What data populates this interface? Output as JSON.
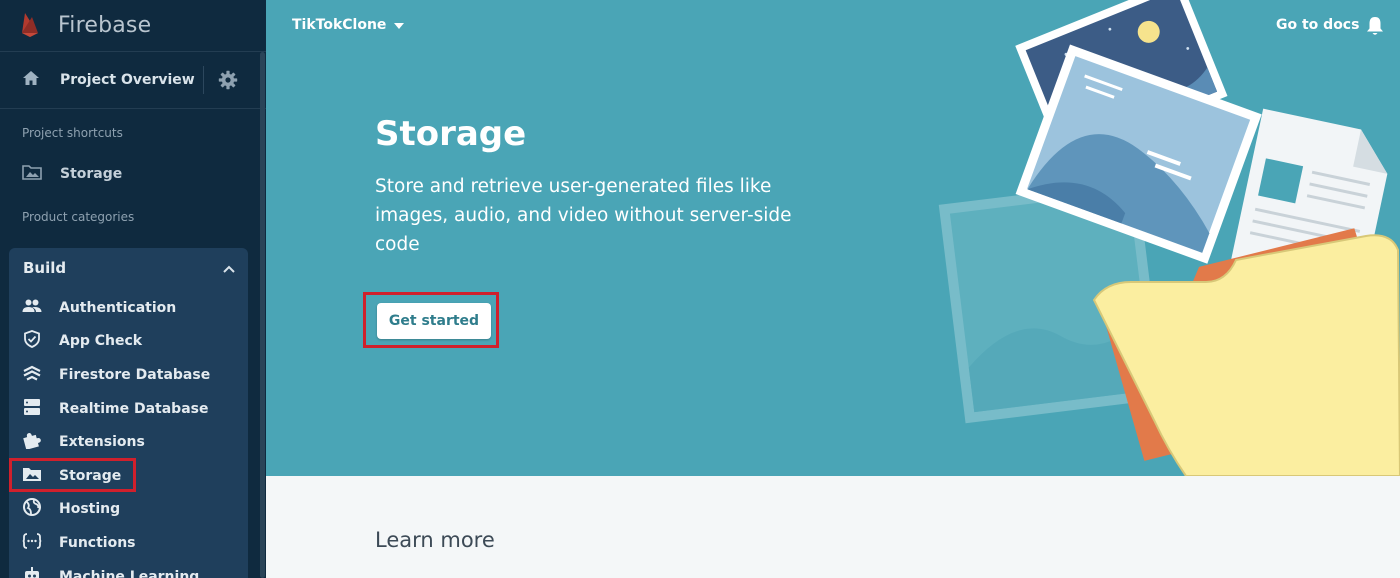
{
  "sidebar": {
    "brand": "Firebase",
    "overview_label": "Project Overview",
    "shortcuts_heading": "Project shortcuts",
    "shortcut_storage": "Storage",
    "categories_heading": "Product categories",
    "build_label": "Build",
    "build_items": [
      {
        "label": "Authentication",
        "icon": "people-icon"
      },
      {
        "label": "App Check",
        "icon": "shield-icon"
      },
      {
        "label": "Firestore Database",
        "icon": "firestore-icon"
      },
      {
        "label": "Realtime Database",
        "icon": "database-icon"
      },
      {
        "label": "Extensions",
        "icon": "puzzle-icon"
      },
      {
        "label": "Storage",
        "icon": "folder-image-icon"
      },
      {
        "label": "Hosting",
        "icon": "globe-icon"
      },
      {
        "label": "Functions",
        "icon": "functions-icon"
      },
      {
        "label": "Machine Learning",
        "icon": "robot-icon"
      }
    ]
  },
  "topbar": {
    "project_name": "TikTokClone",
    "docs_link": "Go to docs"
  },
  "hero": {
    "title": "Storage",
    "description": "Store and retrieve user-generated files like images, audio, and video without server-side code",
    "cta_label": "Get started"
  },
  "learn_more": "Learn more",
  "colors": {
    "sidebar_bg": "#0f2a3f",
    "build_panel_bg": "#1f3f5c",
    "hero_bg": "#4aa5b6",
    "highlight": "#d0202c"
  }
}
